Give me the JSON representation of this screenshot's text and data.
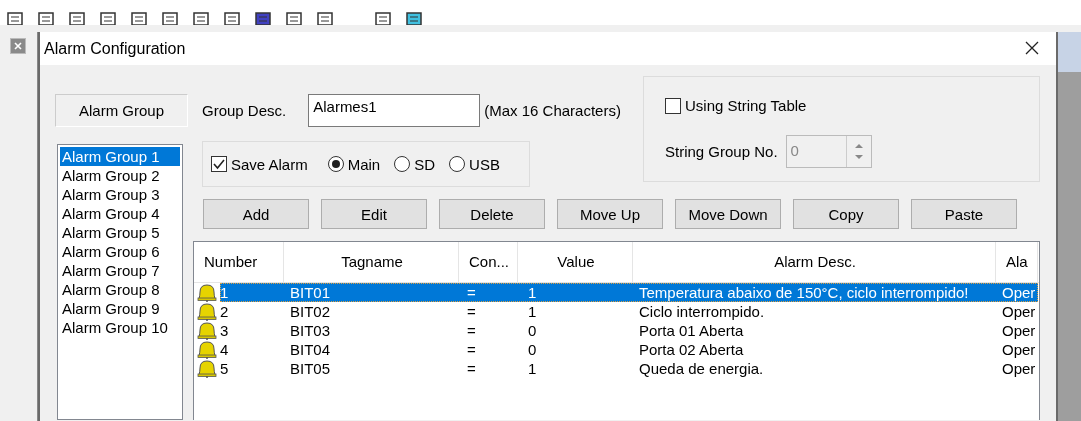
{
  "window": {
    "title": "Alarm Configuration"
  },
  "alarm_group_header": "Alarm Group",
  "groups": [
    {
      "label": "Alarm Group 1",
      "selected": true
    },
    {
      "label": "Alarm Group 2",
      "selected": false
    },
    {
      "label": "Alarm Group 3",
      "selected": false
    },
    {
      "label": "Alarm Group 4",
      "selected": false
    },
    {
      "label": "Alarm Group 5",
      "selected": false
    },
    {
      "label": "Alarm Group 6",
      "selected": false
    },
    {
      "label": "Alarm Group 7",
      "selected": false
    },
    {
      "label": "Alarm Group 8",
      "selected": false
    },
    {
      "label": "Alarm Group 9",
      "selected": false
    },
    {
      "label": "Alarm Group 10",
      "selected": false
    }
  ],
  "group_desc": {
    "label": "Group Desc.",
    "value": "Alarmes1",
    "hint": "(Max 16 Characters)"
  },
  "save_alarm": {
    "label": "Save Alarm",
    "checked": true
  },
  "storage": [
    {
      "label": "Main",
      "selected": true
    },
    {
      "label": "SD",
      "selected": false
    },
    {
      "label": "USB",
      "selected": false
    }
  ],
  "string_table": {
    "label": "Using String Table",
    "checked": false
  },
  "string_group": {
    "label": "String Group No.",
    "value": "0",
    "disabled": true
  },
  "buttons": [
    "Add",
    "Edit",
    "Delete",
    "Move Up",
    "Move Down",
    "Copy",
    "Paste"
  ],
  "table": {
    "columns": [
      "Number",
      "Tagname",
      "Con...",
      "Value",
      "Alarm Desc.",
      "Ala"
    ],
    "rows": [
      {
        "cells": [
          "1",
          "BIT01",
          "=",
          "1",
          "Temperatura abaixo de 150°C, ciclo interrompido!",
          "Oper"
        ],
        "selected": true
      },
      {
        "cells": [
          "2",
          "BIT02",
          "=",
          "1",
          "Ciclo interrompido.",
          "Oper"
        ],
        "selected": false
      },
      {
        "cells": [
          "3",
          "BIT03",
          "=",
          "0",
          "Porta 01 Aberta",
          "Oper"
        ],
        "selected": false
      },
      {
        "cells": [
          "4",
          "BIT04",
          "=",
          "0",
          "Porta 02 Aberta",
          "Oper"
        ],
        "selected": false
      },
      {
        "cells": [
          "5",
          "BIT05",
          "=",
          "1",
          "Queda de energia.",
          "Oper"
        ],
        "selected": false
      }
    ]
  }
}
